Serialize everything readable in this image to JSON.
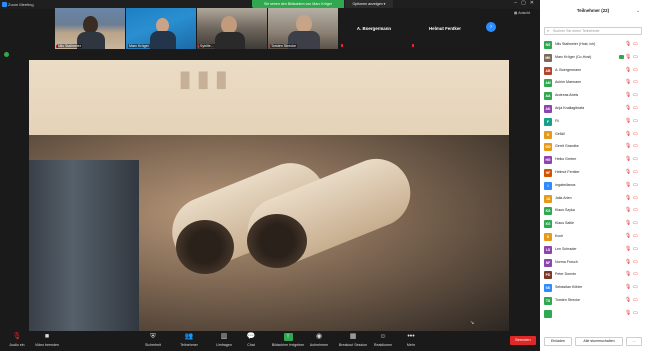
{
  "window": {
    "title": "Zoom Meeting"
  },
  "banner": {
    "share_text": "Sie sehen den Bildschirm von Marc Kröger",
    "view_options": "Optionen anzeigen ▾"
  },
  "view_label": "Ansicht",
  "thumbnails": [
    {
      "name": "Nils Stallmeier"
    },
    {
      "name": "Marc Kröger"
    },
    {
      "name": "Sybille..."
    },
    {
      "name": "Torsten Strecke"
    }
  ],
  "name_tiles": [
    "A. Boergermann",
    "Helmut Fentker"
  ],
  "toolbar": {
    "audio": "Audio ein",
    "video": "Video beenden",
    "security": "Sicherheit",
    "participants": "Teilnehmer",
    "participants_count": "22",
    "polls": "Umfragen",
    "chat": "Chat",
    "share": "Bildschirm freigeben",
    "record": "Aufnehmen",
    "breakout": "Breakout Session",
    "reactions": "Reaktionen",
    "more": "Mehr",
    "end": "Beenden"
  },
  "panel": {
    "title": "Teilnehmer (22)",
    "search_placeholder": "Suchen Sie einen Teilnehmer",
    "invite": "Einladen",
    "mute_all": "Alle stummschalten",
    "more": "..."
  },
  "participants": [
    {
      "initials": "NS",
      "name": "Nils Stallmeier (Host, ich)",
      "color": "#2fa84f"
    },
    {
      "initials": "MK",
      "name": "Marc Kröger (Co-Host)",
      "color": "#7a6a58",
      "camera_on": true
    },
    {
      "initials": "AB",
      "name": "A. Boergermann",
      "color": "#b3432f"
    },
    {
      "initials": "AM",
      "name": "Achim Marmann",
      "color": "#2fa84f"
    },
    {
      "initials": "AA",
      "name": "Andreas Abels",
      "color": "#2fa84f"
    },
    {
      "initials": "AK",
      "name": "Anja Knallagibrafa",
      "color": "#8e44ad"
    },
    {
      "initials": "F",
      "name": "Fil",
      "color": "#16a085"
    },
    {
      "initials": "G",
      "name": "GefAll",
      "color": "#e59a1a"
    },
    {
      "initials": "GG",
      "name": "Gerrit Grandke",
      "color": "#e59a1a"
    },
    {
      "initials": "HG",
      "name": "Heiko Greber",
      "color": "#8e44ad"
    },
    {
      "initials": "HF",
      "name": "Helmut Fentker",
      "color": "#d35400"
    },
    {
      "initials": "I",
      "name": "Ingabellanos",
      "color": "#2d8cff"
    },
    {
      "initials": "JA",
      "name": "Jalla Arlen",
      "color": "#e59a1a"
    },
    {
      "initials": "KS",
      "name": "Klaus Szyka",
      "color": "#2fa84f"
    },
    {
      "initials": "KS",
      "name": "Klaus Saltle",
      "color": "#2fa84f"
    },
    {
      "initials": "K",
      "name": "Koch",
      "color": "#e59a1a"
    },
    {
      "initials": "LS",
      "name": "Len Schrader",
      "color": "#8e44ad"
    },
    {
      "initials": "NF",
      "name": "Norma Frosch",
      "color": "#8e44ad"
    },
    {
      "initials": "PD",
      "name": "Peter Dormin",
      "color": "#7a3a2a"
    },
    {
      "initials": "SK",
      "name": "Sebastian Köhler",
      "color": "#2d8cff"
    },
    {
      "initials": "TS",
      "name": "Torsten Strecke",
      "color": "#2fa84f"
    },
    {
      "initials": "",
      "name": "",
      "color": "#2fa84f"
    }
  ]
}
